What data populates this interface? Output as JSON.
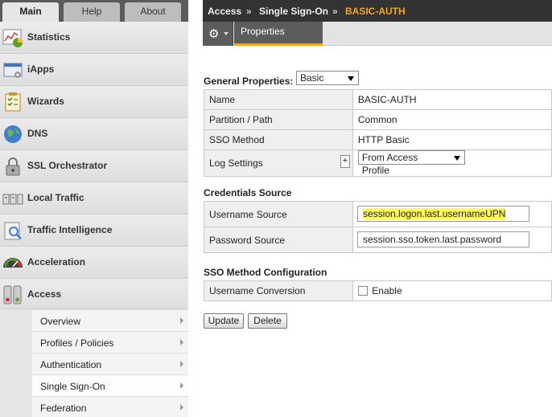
{
  "nav": {
    "tabs": [
      "Main",
      "Help",
      "About"
    ],
    "items": [
      {
        "label": "Statistics",
        "icon": "statistics-icon"
      },
      {
        "label": "iApps",
        "icon": "iapps-icon"
      },
      {
        "label": "Wizards",
        "icon": "wizards-icon"
      },
      {
        "label": "DNS",
        "icon": "dns-globe-icon"
      },
      {
        "label": "SSL Orchestrator",
        "icon": "ssl-lock-icon"
      },
      {
        "label": "Local Traffic",
        "icon": "local-traffic-icon"
      },
      {
        "label": "Traffic Intelligence",
        "icon": "traffic-intelligence-icon"
      },
      {
        "label": "Acceleration",
        "icon": "acceleration-gauge-icon"
      },
      {
        "label": "Access",
        "icon": "access-icon"
      }
    ],
    "access_subitems": [
      "Overview",
      "Profiles / Policies",
      "Authentication",
      "Single Sign-On",
      "Federation"
    ]
  },
  "breadcrumb": {
    "section": "Access",
    "sep": "»",
    "subsection": "Single Sign-On",
    "current": "BASIC-AUTH"
  },
  "toolbar": {
    "tab": "Properties"
  },
  "general": {
    "label": "General Properties:",
    "view_select": "Basic",
    "rows": [
      {
        "key": "Name",
        "value": "BASIC-AUTH"
      },
      {
        "key": "Partition / Path",
        "value": "Common"
      },
      {
        "key": "SSO Method",
        "value": "HTTP Basic"
      },
      {
        "key": "Log Settings",
        "plus": "+",
        "select": "From Access Profile"
      }
    ]
  },
  "credentials": {
    "label": "Credentials Source",
    "username_label": "Username Source",
    "username_value": "session.logon.last.usernameUPN",
    "password_label": "Password Source",
    "password_value": "session.sso.token.last.password"
  },
  "sso_config": {
    "label": "SSO Method Configuration",
    "conversion_label": "Username Conversion",
    "enable_label": "Enable"
  },
  "buttons": {
    "update": "Update",
    "delete": "Delete"
  },
  "colors": {
    "accent": "#f5a623",
    "highlight": "#fffa54",
    "header_bg": "#333333"
  }
}
